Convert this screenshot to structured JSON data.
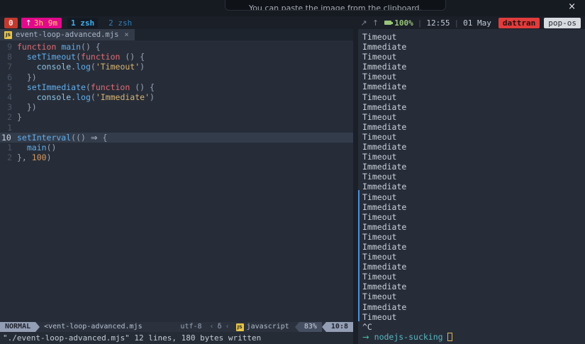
{
  "notification": {
    "text": "You can paste the image from the clipboard.",
    "close_icon": "×"
  },
  "tmux": {
    "session": "0",
    "uptime_icon": "↑",
    "uptime": "3h 9m",
    "windows": [
      {
        "label": "1 zsh"
      },
      {
        "label": "2 zsh"
      }
    ],
    "net_icons": "↗ ↑",
    "battery": "100%",
    "sep": "|",
    "time": "12:55",
    "date": "01 May",
    "user": "dattran",
    "host": "pop-os"
  },
  "editor": {
    "tab": {
      "icon": "JS",
      "filename": "event-loop-advanced.mjs",
      "close": "×"
    },
    "lines": [
      {
        "num": "9",
        "current": false,
        "segments": [
          {
            "t": "kw",
            "s": "function"
          },
          {
            "t": "plain",
            "s": " "
          },
          {
            "t": "fn",
            "s": "main"
          },
          {
            "t": "punct",
            "s": "() {"
          }
        ]
      },
      {
        "num": "8",
        "current": false,
        "segments": [
          {
            "t": "plain",
            "s": "  "
          },
          {
            "t": "fn",
            "s": "setTimeout"
          },
          {
            "t": "punct",
            "s": "("
          },
          {
            "t": "kw",
            "s": "function"
          },
          {
            "t": "punct",
            "s": " () {"
          }
        ]
      },
      {
        "num": "7",
        "current": false,
        "segments": [
          {
            "t": "plain",
            "s": "    "
          },
          {
            "t": "obj",
            "s": "console"
          },
          {
            "t": "punct",
            "s": "."
          },
          {
            "t": "fn",
            "s": "log"
          },
          {
            "t": "punct",
            "s": "("
          },
          {
            "t": "str",
            "s": "'Timeout'"
          },
          {
            "t": "punct",
            "s": ")"
          }
        ]
      },
      {
        "num": "6",
        "current": false,
        "segments": [
          {
            "t": "plain",
            "s": "  "
          },
          {
            "t": "punct",
            "s": "})"
          }
        ]
      },
      {
        "num": "5",
        "current": false,
        "segments": [
          {
            "t": "plain",
            "s": "  "
          },
          {
            "t": "fn",
            "s": "setImmediate"
          },
          {
            "t": "punct",
            "s": "("
          },
          {
            "t": "kw",
            "s": "function"
          },
          {
            "t": "punct",
            "s": " () {"
          }
        ]
      },
      {
        "num": "4",
        "current": false,
        "segments": [
          {
            "t": "plain",
            "s": "    "
          },
          {
            "t": "obj",
            "s": "console"
          },
          {
            "t": "punct",
            "s": "."
          },
          {
            "t": "fn",
            "s": "log"
          },
          {
            "t": "punct",
            "s": "("
          },
          {
            "t": "str",
            "s": "'Immediate'"
          },
          {
            "t": "punct",
            "s": ")"
          }
        ]
      },
      {
        "num": "3",
        "current": false,
        "segments": [
          {
            "t": "plain",
            "s": "  "
          },
          {
            "t": "punct",
            "s": "})"
          }
        ]
      },
      {
        "num": "2",
        "current": false,
        "segments": [
          {
            "t": "punct",
            "s": "}"
          }
        ]
      },
      {
        "num": "1",
        "current": false,
        "segments": []
      },
      {
        "num": "10",
        "current": true,
        "segments": [
          {
            "t": "fn",
            "s": "setInterval"
          },
          {
            "t": "punct",
            "s": "(() "
          },
          {
            "t": "arrow",
            "s": "⇒"
          },
          {
            "t": "punct",
            "s": " {"
          }
        ]
      },
      {
        "num": "1",
        "current": false,
        "segments": [
          {
            "t": "plain",
            "s": "  "
          },
          {
            "t": "fn",
            "s": "main"
          },
          {
            "t": "punct",
            "s": "()"
          }
        ]
      },
      {
        "num": "2",
        "current": false,
        "segments": [
          {
            "t": "punct",
            "s": "}, "
          },
          {
            "t": "num",
            "s": "100"
          },
          {
            "t": "punct",
            "s": ")"
          }
        ]
      }
    ],
    "statusline": {
      "mode": "NORMAL",
      "file": "<vent-loop-advanced.mjs",
      "encoding": "utf-8",
      "sep": "‹",
      "os_icon": "δ",
      "lang_icon": "JS",
      "lang": "javascript",
      "progress": "83%",
      "location": "10:8"
    },
    "cmdline": "\"./event-loop-advanced.mjs\" 12 lines, 180 bytes written"
  },
  "terminal": {
    "output": [
      "Timeout",
      "Immediate",
      "Timeout",
      "Immediate",
      "Timeout",
      "Immediate",
      "Timeout",
      "Immediate",
      "Timeout",
      "Immediate",
      "Timeout",
      "Immediate",
      "Timeout",
      "Immediate",
      "Timeout",
      "Immediate",
      "Timeout",
      "Immediate",
      "Timeout",
      "Immediate",
      "Timeout",
      "Immediate",
      "Timeout",
      "Immediate",
      "Timeout",
      "Immediate",
      "Timeout",
      "Immediate",
      "Timeout"
    ],
    "interrupt": "^C",
    "prompt": {
      "arrow": "→",
      "dir": "nodejs-sucking"
    }
  },
  "colors": {
    "session_red": "#c23a2f",
    "uptime_magenta": "#e20a8b",
    "window_cyan": "#41b0f0",
    "battery_green": "#98c379",
    "user_chip_red": "#e23c3c",
    "host_chip_grey": "#d8dbe0",
    "keyword_red": "#e06c75",
    "function_blue": "#61afef",
    "string_yellow": "#d8b572",
    "number_orange": "#d89a62",
    "pane_border_blue": "#4a90d9",
    "cursor_yellow": "#e0b75a"
  }
}
